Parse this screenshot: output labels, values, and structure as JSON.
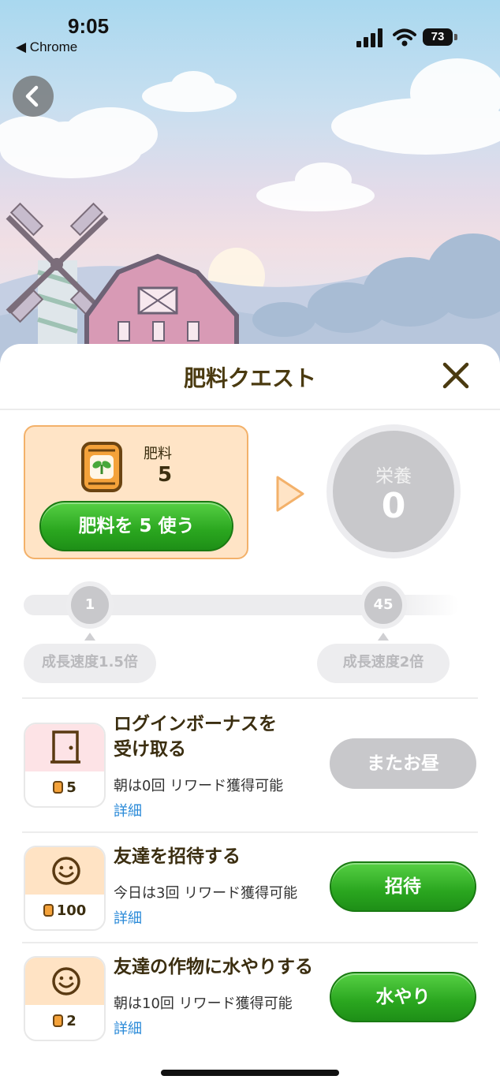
{
  "status_bar": {
    "time": "9:05",
    "back_app": "◀ Chrome",
    "battery": "73"
  },
  "sheet": {
    "title": "肥料クエスト",
    "fertilizer": {
      "label": "肥料",
      "count": "5",
      "use_button": "肥料を 5 使う"
    },
    "nutrition": {
      "label": "栄養",
      "value": "0"
    },
    "progress": {
      "current_value": 0,
      "nodes": [
        {
          "value": "1",
          "bonus_label": "成長速度1.5倍"
        },
        {
          "value": "45",
          "bonus_label": "成長速度2倍"
        }
      ]
    },
    "tasks": [
      {
        "title_line1": "ログインボーナスを",
        "title_line2": "受け取る",
        "subtitle": "朝は0回 リワード獲得可能",
        "detail": "詳細",
        "reward": "5",
        "icon": "door-icon",
        "button": "またお昼",
        "button_state": "disabled",
        "card_color": "#fde3e6"
      },
      {
        "title_line1": "友達を招待する",
        "subtitle": "今日は3回 リワード獲得可能",
        "detail": "詳細",
        "reward": "100",
        "icon": "smiley-icon",
        "button": "招待",
        "button_state": "active",
        "card_color": "#ffe3c4"
      },
      {
        "title_line1": "友達の作物に水やりする",
        "subtitle": "朝は10回 リワード獲得可能",
        "detail": "詳細",
        "reward": "2",
        "icon": "smiley-icon",
        "button": "水やり",
        "button_state": "active",
        "card_color": "#ffe3c4"
      }
    ]
  },
  "colors": {
    "accent_green": "#2aa61f",
    "card_orange": "#ffe4c6",
    "title_brown": "#3b2e10",
    "link_blue": "#2a8ad8"
  }
}
